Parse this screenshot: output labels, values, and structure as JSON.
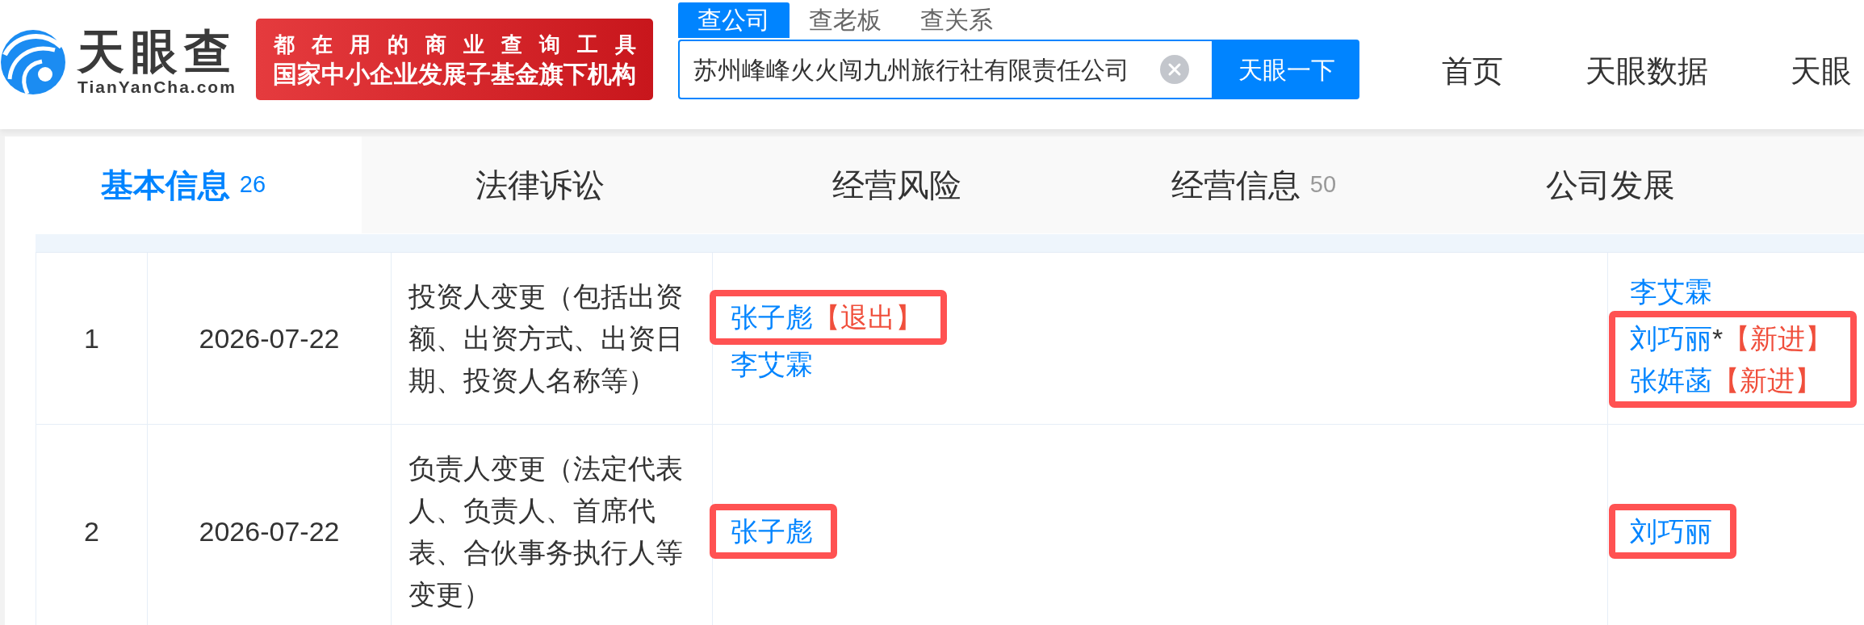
{
  "header": {
    "logo": {
      "name": "天眼查",
      "domain": "TianYanCha.com"
    },
    "banner": {
      "slogan": "都在用的商业查询工具",
      "tagline": "国家中小企业发展子基金旗下机构"
    },
    "search": {
      "tabs": [
        {
          "label": "查公司",
          "selected": true
        },
        {
          "label": "查老板",
          "selected": false
        },
        {
          "label": "查关系",
          "selected": false
        }
      ],
      "value": "苏州峰峰火火闯九州旅行社有限责任公司",
      "button": "天眼一下"
    },
    "nav": [
      "首页",
      "天眼数据",
      "天眼"
    ]
  },
  "tabs": [
    {
      "label": "基本信息",
      "count": "26",
      "selected": true
    },
    {
      "label": "法律诉讼",
      "selected": false
    },
    {
      "label": "经营风险",
      "selected": false
    },
    {
      "label": "经营信息",
      "count": "50",
      "selected": false
    },
    {
      "label": "公司发展",
      "selected": false
    }
  ],
  "table": {
    "rows": [
      {
        "column_1": "1",
        "column_2": "2026-07-22",
        "column_3": "投资人变更（包括出资额、出资方式、出资日期、投资人名称等）",
        "column_4": [
          {
            "highlighted": true,
            "entries": [
              {
                "name": "张子彪",
                "tag": "【退出】"
              }
            ]
          },
          {
            "highlighted": false,
            "entries": [
              {
                "name": "李艾霖"
              }
            ]
          }
        ],
        "column_5": [
          {
            "highlighted": false,
            "entries": [
              {
                "name": "李艾霖"
              }
            ]
          },
          {
            "highlighted": true,
            "entries": [
              {
                "name": "刘巧丽",
                "mark": "*",
                "tag": "【新进】"
              },
              {
                "name": "张姩菡",
                "tag": "【新进】"
              }
            ]
          }
        ]
      },
      {
        "column_1": "2",
        "column_2": "2026-07-22",
        "column_3": "负责人变更（法定代表人、负责人、首席代表、合伙事务执行人等变更）",
        "column_4": [
          {
            "highlighted": true,
            "entries": [
              {
                "name": "张子彪"
              }
            ]
          }
        ],
        "column_5": [
          {
            "highlighted": true,
            "entries": [
              {
                "name": "刘巧丽"
              }
            ]
          }
        ]
      }
    ]
  }
}
